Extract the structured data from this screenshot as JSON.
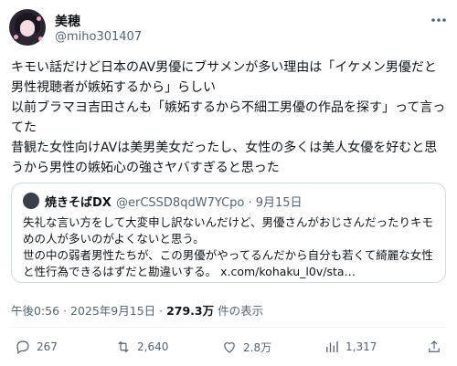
{
  "author": {
    "name": "美穂",
    "handle": "@miho301407",
    "more_icon": "more-horizontal-icon"
  },
  "post": {
    "text": "キモい話だけど日本のAV男優にブサメンが多い理由は「イケメン男優だと男性視聴者が嫉妬するから」らしい\n以前ブラマヨ吉田さんも「嫉妬するから不細工男優の作品を探す」って言ってた\n昔観た女性向けAVは美男美女だったし、女性の多くは美人女優を好むと思うから男性の嫉妬心の強さヤバすぎると思った"
  },
  "quote": {
    "name": "焼きそばDX",
    "handle": "@erCSSD8qdW7YCpo · 9月15日",
    "text": "失礼な言い方をして大変申し訳ないんだけど、男優さんがおじさんだったりキモめの人が多いのがよくないと思う。\n世の中の弱者男性たちが、この男優がやってるんだから自分も若くて綺麗な女性と性行為できるはずだと勘違いする。 x.com/kohaku_l0v/sta…"
  },
  "meta": {
    "time": "午後0:56 · 2025年9月15日 · ",
    "views": "279.3万",
    "views_suffix": " 件の表示"
  },
  "actions": {
    "replies": "267",
    "reposts": "2,640",
    "likes": "2.8万",
    "bookmarks": "1,317"
  },
  "colors": {
    "text": "#0f1419",
    "muted": "#536471",
    "border": "#cfd9de"
  }
}
